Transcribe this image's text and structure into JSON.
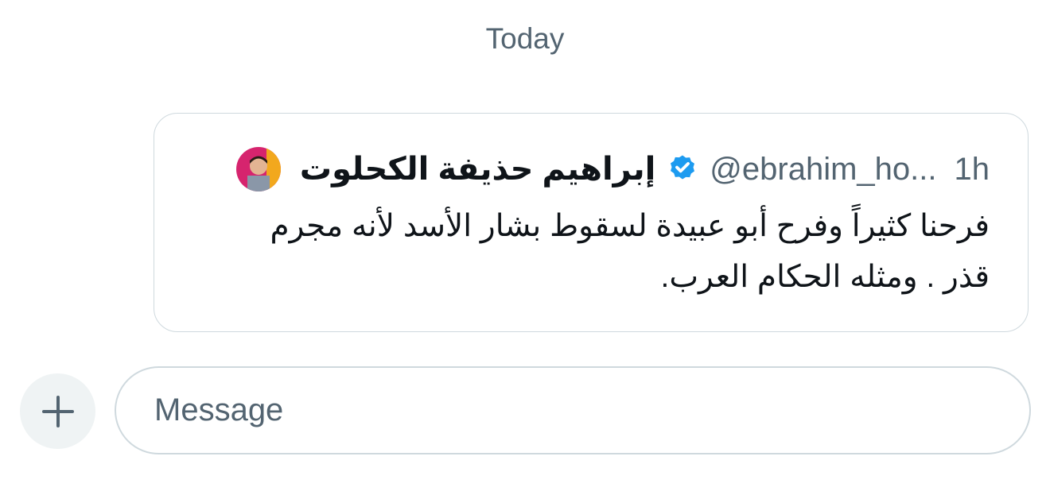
{
  "conversation": {
    "date_separator": "Today"
  },
  "quoted_post": {
    "author_name": "إبراهيم حذيفة الكحلوت",
    "verified": true,
    "handle": "@ebrahim_ho...",
    "timestamp": "1h",
    "text": "فرحنا كثيراً وفرح أبو عبيدة لسقوط بشار الأسد لأنه مجرم قذر . ومثله الحكام العرب.",
    "colors": {
      "verified_badge": "#1d9bf0",
      "avatar_background": "#d6246e"
    }
  },
  "composer": {
    "add_icon": "plus-icon",
    "message_value": "",
    "message_placeholder": "Message"
  }
}
